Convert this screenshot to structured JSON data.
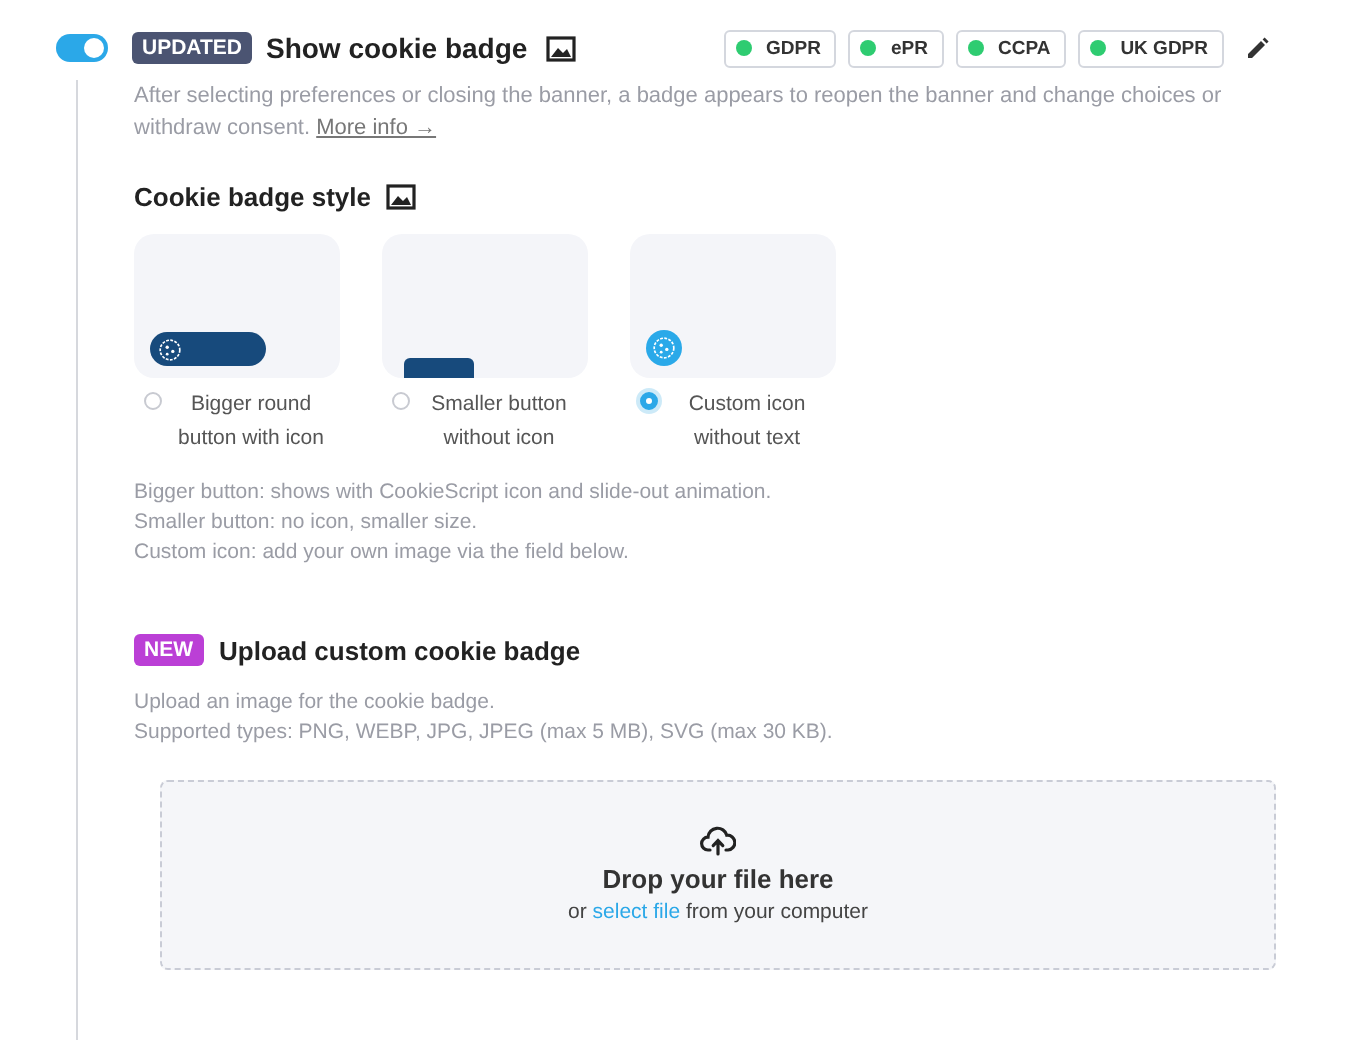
{
  "feature": {
    "enabled": true,
    "tag": "UPDATED",
    "title": "Show cookie badge",
    "description": "After selecting preferences or closing the banner, a badge appears to reopen the banner and change choices or withdraw consent.",
    "link": "More info",
    "link_arrow": "→"
  },
  "regulations": [
    {
      "label": "GDPR",
      "color": "#2ecc71"
    },
    {
      "label": "ePR",
      "color": "#2ecc71"
    },
    {
      "label": "CCPA",
      "color": "#2ecc71"
    },
    {
      "label": "UK GDPR",
      "color": "#2ecc71"
    }
  ],
  "badge_style": {
    "title": "Cookie badge style",
    "options": [
      {
        "kind": "round",
        "label": "Bigger round button with icon",
        "selected": false
      },
      {
        "kind": "small",
        "label": "Smaller button without icon",
        "selected": false
      },
      {
        "kind": "icon",
        "label": "Custom icon without text",
        "selected": true
      }
    ],
    "notes": [
      "Bigger button: shows with CookieScript icon and slide-out animation.",
      "Smaller button: no icon, smaller size.",
      "Custom icon: add your own image via the field below."
    ]
  },
  "upload": {
    "tag": "NEW",
    "title": "Upload custom cookie badge",
    "notes": [
      "Upload an image for the cookie badge.",
      "Supported types: PNG, WEBP, JPG, JPEG (max 5 MB), SVG (max 30 KB)."
    ],
    "drop_title": "Drop your file here",
    "drop_prefix": "or",
    "drop_link": "select file",
    "drop_suffix": "from your computer"
  }
}
